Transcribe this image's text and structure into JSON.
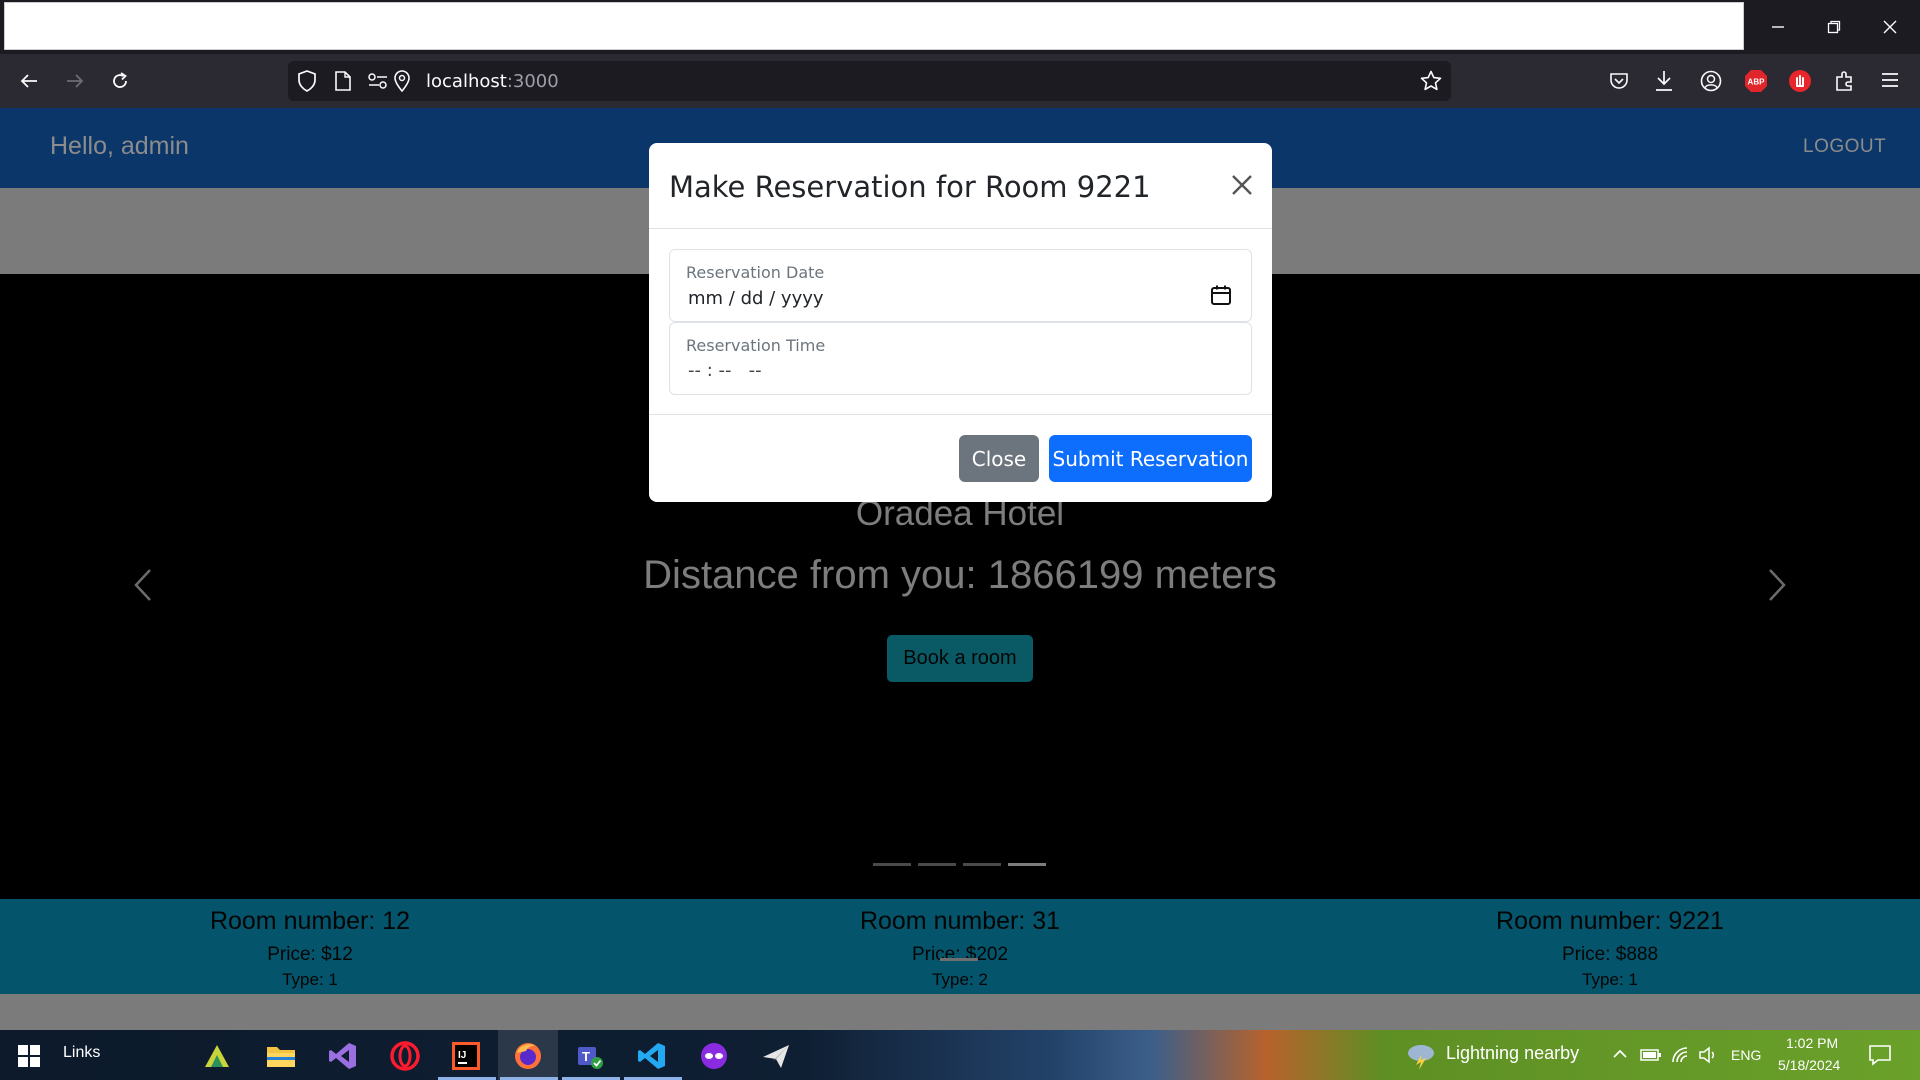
{
  "browser": {
    "url_host": "localhost",
    "url_port": ":3000"
  },
  "navbar": {
    "greeting": "Hello, admin",
    "logout_label": "LOGOUT"
  },
  "carousel": {
    "hotel_name": "Oradea Hotel",
    "distance": "Distance from you: 1866199 meters",
    "book_label": "Book a room",
    "indicator_count": 4,
    "active_indicator": 4
  },
  "rooms": [
    {
      "number": "Room number: 12",
      "price": "Price: $12",
      "type": "Type: 1"
    },
    {
      "number": "Room number: 31",
      "price": "Price: $202",
      "type": "Type: 2"
    },
    {
      "number": "Room number: 9221",
      "price": "Price: $888",
      "type": "Type: 1"
    }
  ],
  "modal": {
    "title": "Make Reservation for Room 9221",
    "date_label": "Reservation Date",
    "date_value": "mm / dd / yyyy",
    "time_label": "Reservation Time",
    "time_value": "-- : --   --",
    "close_label": "Close",
    "submit_label": "Submit Reservation"
  },
  "taskbar": {
    "links_label": "Links",
    "weather": "Lightning nearby",
    "language": "ENG",
    "time": "1:02 PM",
    "date": "5/18/2024"
  },
  "colors": {
    "navbar": "#0b3669",
    "primary": "#0d6efd",
    "secondary": "#6c757d",
    "rooms_strip": "#04546b"
  }
}
